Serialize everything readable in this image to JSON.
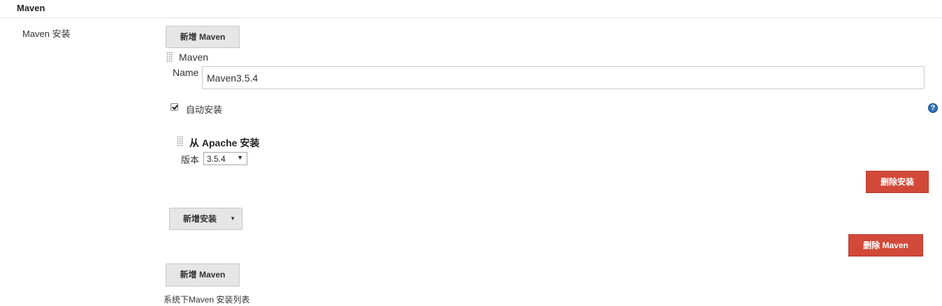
{
  "section": {
    "title": "Maven"
  },
  "maven": {
    "row_label": "Maven 安装",
    "add_button_top": "新增 Maven",
    "installation": {
      "header": "Maven",
      "name_label": "Name",
      "name_value": "Maven3.5.4",
      "auto_install_label": "自动安装",
      "auto_install_checked": true,
      "installer": {
        "header": "从 Apache 安装",
        "version_label": "版本",
        "version_value": "3.5.4"
      },
      "delete_installer_button": "删除安装",
      "add_installer_button": "新增安装",
      "delete_maven_button": "删除 Maven"
    },
    "add_button_bottom": "新增 Maven",
    "description": "系统下Maven 安装列表"
  },
  "icons": {
    "help": "help-icon",
    "drag": "drag-handle-icon",
    "dropdown": "chevron-down-icon"
  },
  "colors": {
    "danger": "#d24939",
    "help": "#2f6fb4",
    "button_gray": "#e6e6e6"
  }
}
